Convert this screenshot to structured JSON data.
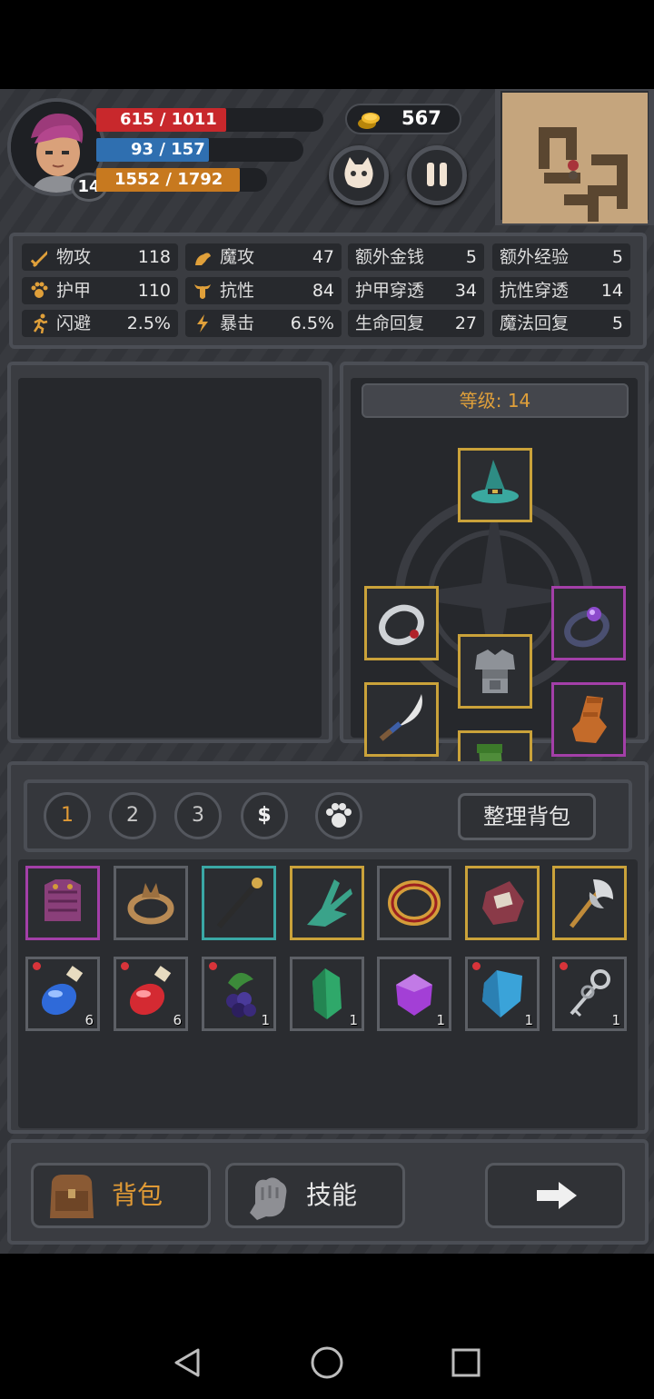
{
  "player": {
    "level": "14",
    "hp": "615 / 1011",
    "mp": "93 / 157",
    "xp": "1552 / 1792",
    "hp_fill": 0.608,
    "mp_fill": 0.592,
    "xp_fill": 0.866
  },
  "gold": "567",
  "stats": [
    {
      "label": "物攻",
      "value": "118",
      "icon": "sword-icon"
    },
    {
      "label": "魔攻",
      "value": "47",
      "icon": "magic-hand-icon"
    },
    {
      "label": "额外金钱",
      "value": "5"
    },
    {
      "label": "额外经验",
      "value": "5"
    },
    {
      "label": "护甲",
      "value": "110",
      "icon": "paw-icon"
    },
    {
      "label": "抗性",
      "value": "84",
      "icon": "bull-icon"
    },
    {
      "label": "护甲穿透",
      "value": "34"
    },
    {
      "label": "抗性穿透",
      "value": "14"
    },
    {
      "label": "闪避",
      "value": "2.5%",
      "icon": "running-icon"
    },
    {
      "label": "暴击",
      "value": "6.5%",
      "icon": "lightning-icon"
    },
    {
      "label": "生命回复",
      "value": "27"
    },
    {
      "label": "魔法回复",
      "value": "5"
    }
  ],
  "equipment": {
    "level_label": "等级: 14"
  },
  "bag": {
    "tabs": [
      "1",
      "2",
      "3",
      "$"
    ],
    "organize_label": "整理背包",
    "counts": [
      "6",
      "6",
      "1",
      "1",
      "1",
      "1",
      "1"
    ]
  },
  "bottom": {
    "bag_label": "背包",
    "skills_label": "技能"
  },
  "colors": {
    "hp": "#c8282c",
    "mp": "#2f6fb0",
    "xp": "#c7791f",
    "gold_border": "#caa23a",
    "purple_border": "#a33fa8",
    "teal_border": "#3aa8a5",
    "level_text": "#e0a03a"
  }
}
